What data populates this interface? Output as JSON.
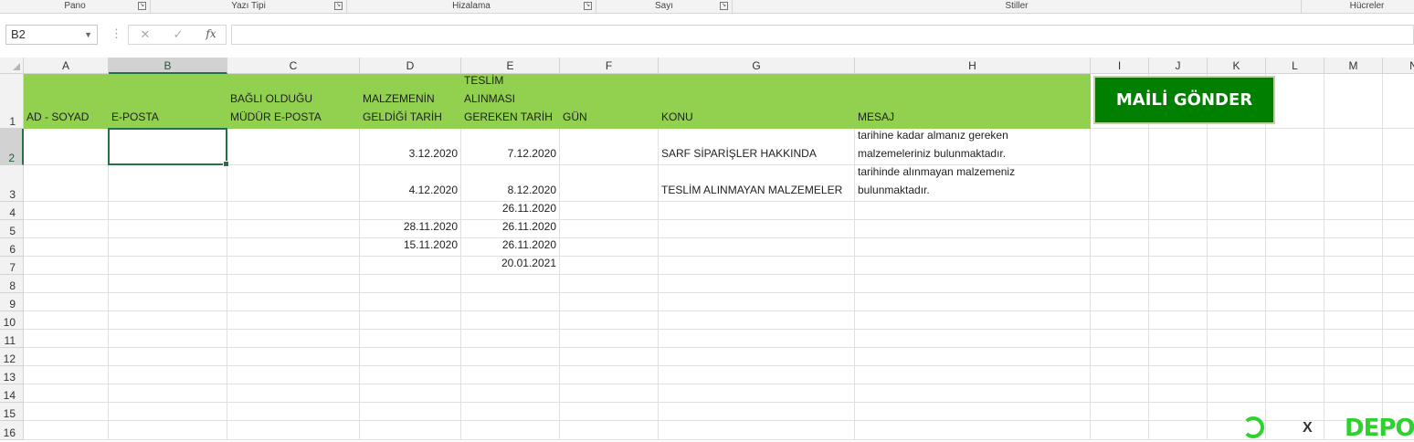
{
  "ribbon": {
    "groups": [
      "Pano",
      "Yazı Tipi",
      "Hizalama",
      "Sayı",
      "Stiller",
      "Hücreler"
    ]
  },
  "formula_bar": {
    "name_box": "B2",
    "cancel_icon": "✕",
    "enter_icon": "✓",
    "fx_label": "fx",
    "formula": ""
  },
  "columns": [
    "A",
    "B",
    "C",
    "D",
    "E",
    "F",
    "G",
    "H",
    "I",
    "J",
    "K",
    "L",
    "M",
    "N"
  ],
  "rows": [
    "1",
    "2",
    "3",
    "4",
    "5",
    "6",
    "7",
    "8",
    "9",
    "10",
    "11",
    "12",
    "13",
    "14",
    "15",
    "16"
  ],
  "headers": {
    "A": "AD - SOYAD",
    "B": "E-POSTA",
    "C": "BAĞLI OLDUĞU\nMÜDÜR E-POSTA",
    "D": "MALZEMENİN\nGELDİĞİ TARİH",
    "E": "TESLİM\nALINMASI\nGEREKEN TARİH",
    "F": "GÜN",
    "G": "KONU",
    "H": "MESAJ"
  },
  "cells": {
    "D2": "3.12.2020",
    "E2": "7.12.2020",
    "G2": "SARF SİPARİŞLER HAKKINDA",
    "H2": "tarihine kadar almanız gereken\nmalzemeleriniz bulunmaktadır.",
    "D3": "4.12.2020",
    "E3": "8.12.2020",
    "G3": "TESLİM ALINMAYAN MALZEMELER",
    "H3": "tarihinde alınmayan malzemeniz\nbulunmaktadır.",
    "E4": "26.11.2020",
    "D5": "28.11.2020",
    "E5": "26.11.2020",
    "D6": "15.11.2020",
    "E6": "26.11.2020",
    "E7": "20.01.2021"
  },
  "mail_button": {
    "label": "MAİLİ GÖNDER",
    "color": "#007f00"
  },
  "header_fill_color": "#92d050",
  "watermark": {
    "text": "DEPO",
    "mark": "X"
  }
}
